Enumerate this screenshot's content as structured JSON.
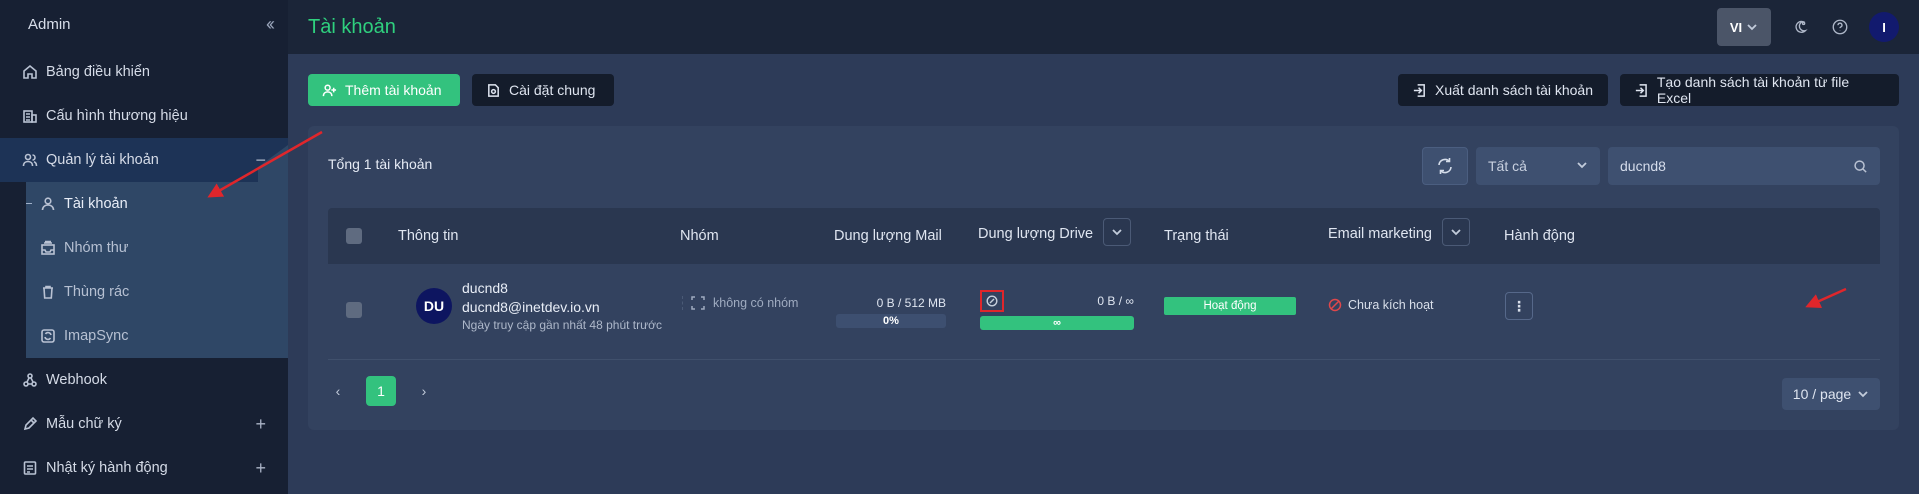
{
  "sidebar": {
    "title": "Admin",
    "collapse_icon": "double-chevron-left-icon",
    "items": [
      {
        "label": "Bảng điều khiển",
        "icon": "home-icon"
      },
      {
        "label": "Cấu hình thương hiệu",
        "icon": "building-icon"
      },
      {
        "label": "Quản lý tài khoản",
        "icon": "users-icon",
        "tail": "−"
      },
      {
        "label": "Webhook",
        "icon": "webhook-icon"
      },
      {
        "label": "Mẫu chữ ký",
        "icon": "pen-icon",
        "tail": "+"
      },
      {
        "label": "Nhật ký hành động",
        "icon": "log-icon",
        "tail": "+"
      }
    ],
    "subitems": [
      {
        "label": "Tài khoản"
      },
      {
        "label": "Nhóm thư"
      },
      {
        "label": "Thùng rác"
      },
      {
        "label": "ImapSync"
      }
    ]
  },
  "topbar": {
    "title": "Tài khoản",
    "lang": "VI",
    "avatar": "I"
  },
  "actions": {
    "add": "Thêm tài khoản",
    "settings": "Cài đặt chung",
    "export": "Xuất danh sách tài khoản",
    "import": "Tạo danh sách tài khoản từ file Excel"
  },
  "table": {
    "total": "Tổng 1 tài khoản",
    "filter": "Tất cả",
    "search_value": "ducnd8",
    "headers": {
      "info": "Thông tin",
      "group": "Nhóm",
      "mail": "Dung lượng Mail",
      "drive": "Dung lượng Drive",
      "status": "Trạng thái",
      "email_marketing": "Email marketing",
      "action": "Hành động"
    },
    "rows": [
      {
        "avatar": "DU",
        "username": "ducnd8",
        "email": "ducnd8@inetdev.io.vn",
        "last_access": "Ngày truy cập gần nhất 48 phút trước",
        "group": "không có nhóm",
        "mail_quota": "0 B / 512 MB",
        "mail_percent": "0%",
        "mail_fill": 0,
        "drive_quota": "0 B / ∞",
        "drive_bar": "∞",
        "drive_fill": 1,
        "status": "Hoạt động",
        "email_marketing": "Chưa kích hoạt"
      }
    ]
  },
  "pagination": {
    "current": "1",
    "page_size": "10 / page"
  },
  "colors": {
    "accent": "#33c27e",
    "annotation": "#e0262b"
  }
}
